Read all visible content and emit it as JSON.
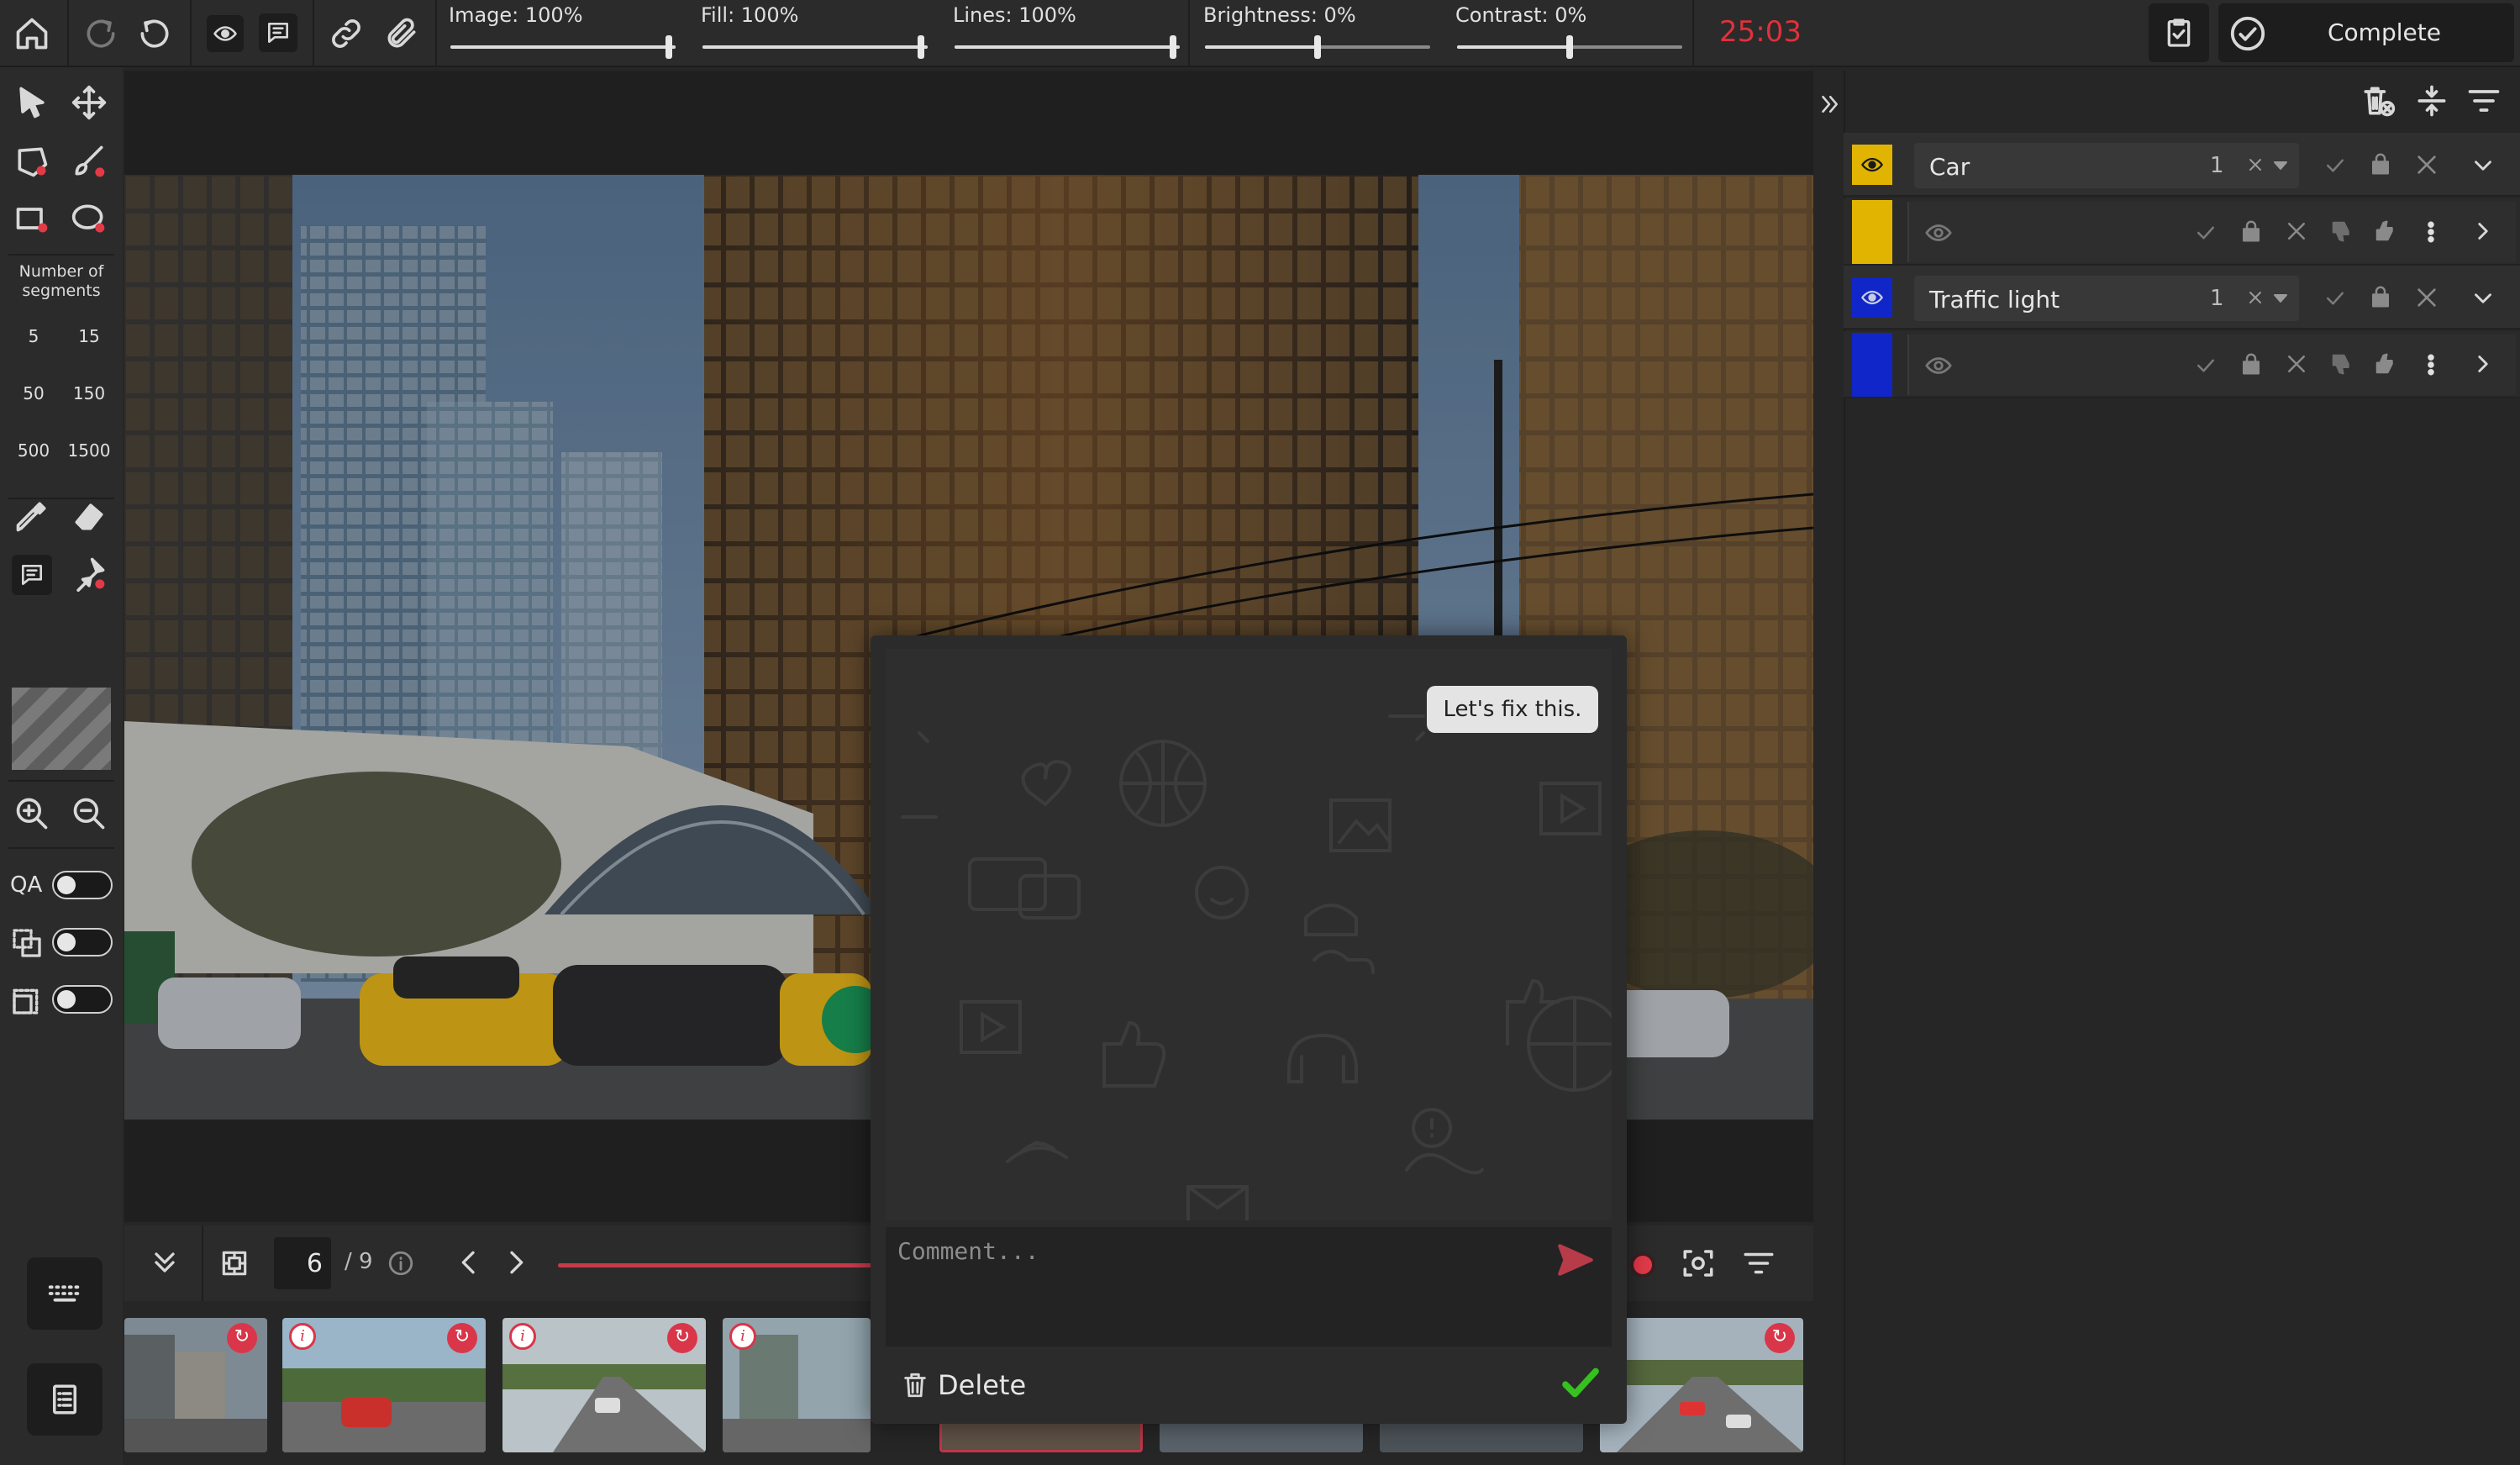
{
  "toolbar": {
    "sliders": {
      "image": "Image: 100%",
      "fill": "Fill: 100%",
      "lines": "Lines: 100%",
      "brightness": "Brightness: 0%",
      "contrast": "Contrast: 0%"
    },
    "timer": "25:03",
    "complete_label": "Complete",
    "icons": [
      "home-icon",
      "undo-icon",
      "redo-icon",
      "eye-icon",
      "comment-icon",
      "link-icon",
      "attach-icon"
    ]
  },
  "tools": {
    "segments_title": "Number of segments",
    "segment_options": [
      "5",
      "15",
      "50",
      "150",
      "500",
      "1500"
    ],
    "qa_label": "QA"
  },
  "frames": {
    "current": "6",
    "total": "/ 9"
  },
  "classes": [
    {
      "name": "Car",
      "count": "1",
      "color": "#e0b400"
    },
    {
      "name": "Traffic light",
      "count": "1",
      "color": "#1026c8"
    }
  ],
  "comment": {
    "bubble_text": "Let's fix this.",
    "placeholder": "Comment...",
    "delete_label": "Delete"
  },
  "colors": {
    "accent_red": "#e0313b",
    "confirm_green": "#35c21e",
    "car_class": "#e0b400",
    "traffic_light_class": "#1026c8"
  }
}
